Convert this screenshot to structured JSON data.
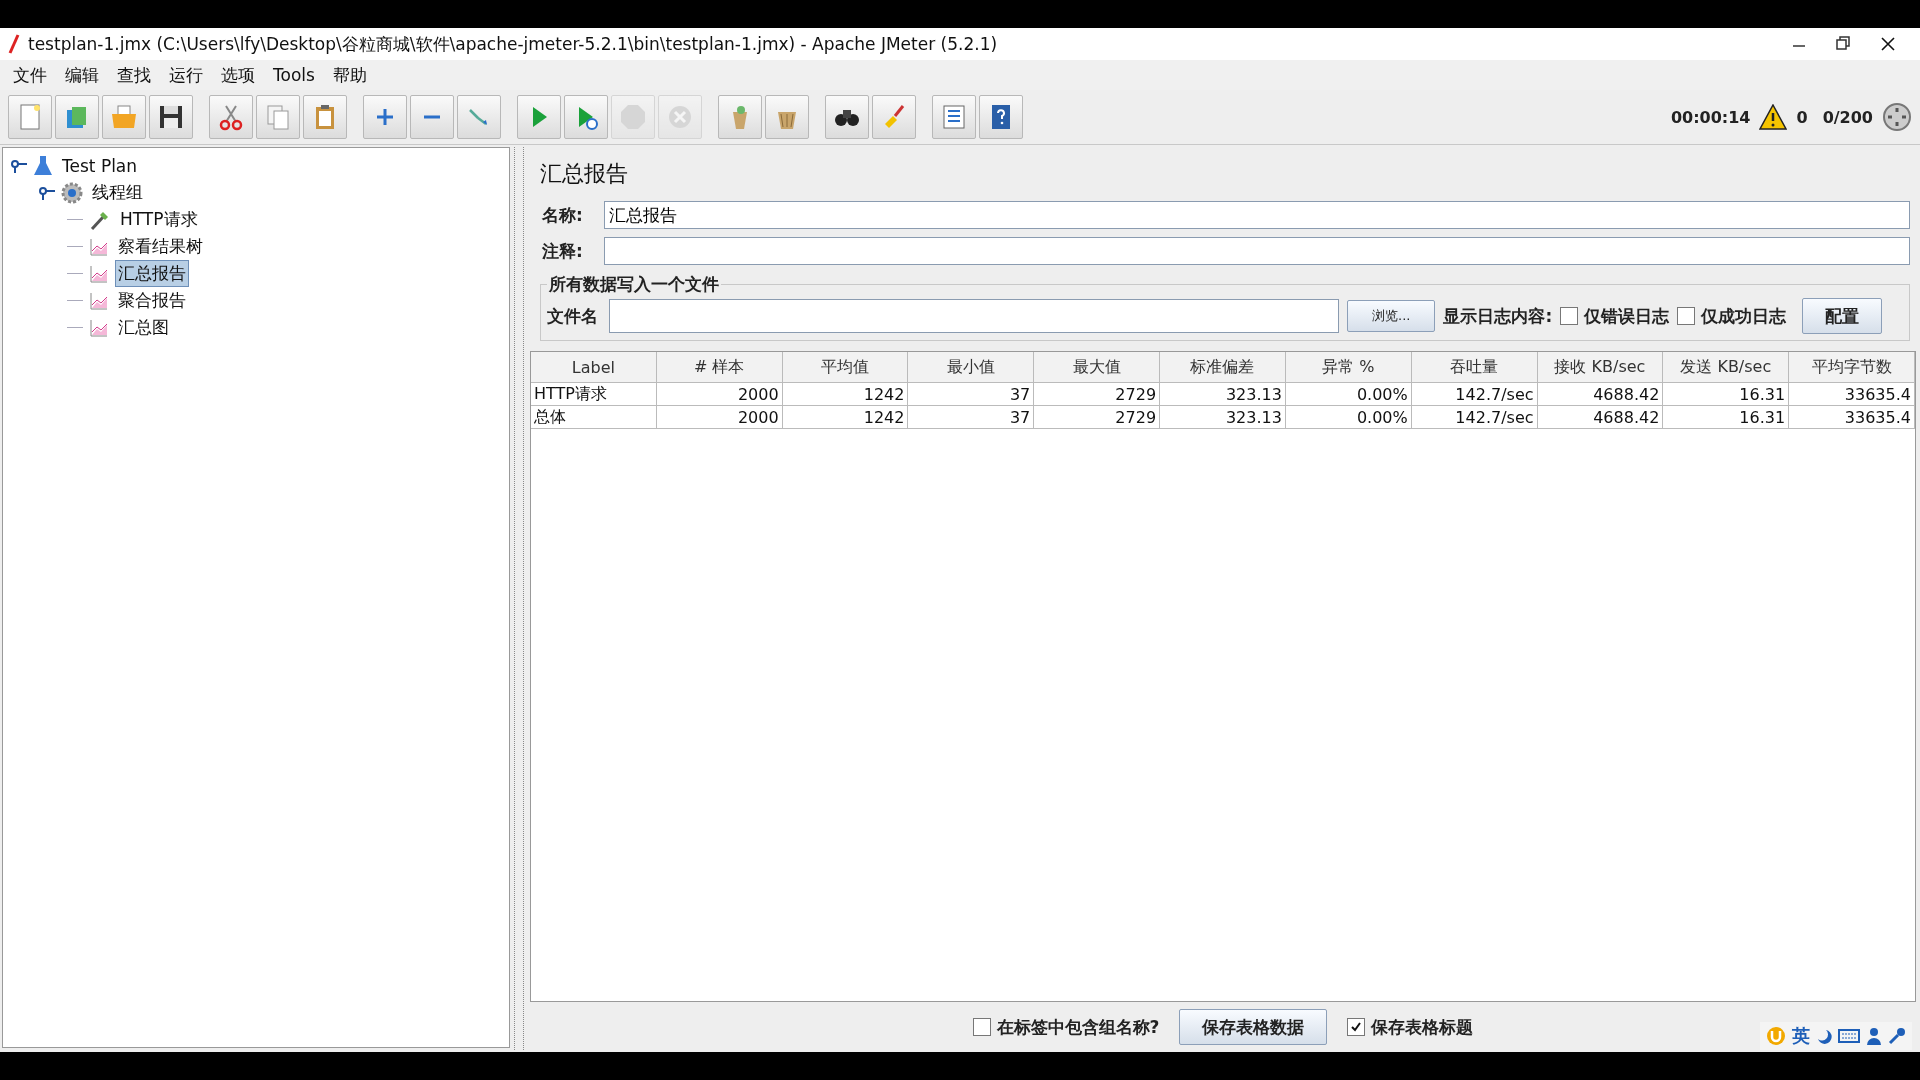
{
  "window": {
    "title": "testplan-1.jmx (C:\\Users\\lfy\\Desktop\\谷粒商城\\软件\\apache-jmeter-5.2.1\\bin\\testplan-1.jmx) - Apache JMeter (5.2.1)"
  },
  "menu": [
    {
      "label": "文件"
    },
    {
      "label": "编辑"
    },
    {
      "label": "查找"
    },
    {
      "label": "运行"
    },
    {
      "label": "选项"
    },
    {
      "label": "Tools"
    },
    {
      "label": "帮助"
    }
  ],
  "toolbar": [
    {
      "kind": "new",
      "disabled": false
    },
    {
      "kind": "templates",
      "disabled": false
    },
    {
      "kind": "open",
      "disabled": false
    },
    {
      "kind": "save",
      "disabled": false
    },
    {
      "kind": "sep"
    },
    {
      "kind": "cut",
      "disabled": false
    },
    {
      "kind": "copy",
      "disabled": false
    },
    {
      "kind": "paste",
      "disabled": false
    },
    {
      "kind": "sep"
    },
    {
      "kind": "expand",
      "disabled": false
    },
    {
      "kind": "collapse",
      "disabled": false
    },
    {
      "kind": "toggle",
      "disabled": false
    },
    {
      "kind": "sep"
    },
    {
      "kind": "start",
      "disabled": false
    },
    {
      "kind": "start_no_pause",
      "disabled": false
    },
    {
      "kind": "stop",
      "disabled": true
    },
    {
      "kind": "shutdown",
      "disabled": true
    },
    {
      "kind": "sep"
    },
    {
      "kind": "clear",
      "disabled": false
    },
    {
      "kind": "clear_all",
      "disabled": false
    },
    {
      "kind": "sep"
    },
    {
      "kind": "search",
      "disabled": false
    },
    {
      "kind": "reset_search",
      "disabled": false
    },
    {
      "kind": "sep"
    },
    {
      "kind": "function_helper",
      "disabled": false
    },
    {
      "kind": "help",
      "disabled": false
    }
  ],
  "status": {
    "elapsed": "00:00:14",
    "warnings": "0",
    "threads": "0/200"
  },
  "tree": [
    {
      "label": "Test Plan",
      "kind": "plan",
      "selected": false,
      "expanded": true,
      "children": [
        {
          "label": "线程组",
          "kind": "thread_group",
          "selected": false,
          "expanded": true,
          "children": [
            {
              "label": "HTTP请求",
              "kind": "sampler",
              "selected": false
            },
            {
              "label": "察看结果树",
              "kind": "listener",
              "selected": false
            },
            {
              "label": "汇总报告",
              "kind": "listener",
              "selected": true
            },
            {
              "label": "聚合报告",
              "kind": "listener",
              "selected": false
            },
            {
              "label": "汇总图",
              "kind": "listener",
              "selected": false
            }
          ]
        }
      ]
    }
  ],
  "panel": {
    "title": "汇总报告",
    "name_label": "名称:",
    "name_value": "汇总报告",
    "comment_label": "注释:"
  },
  "file_group": {
    "title": "所有数据写入一个文件",
    "filename_label": "文件名",
    "browse_button": "浏览...",
    "log_label": "显示日志内容:",
    "checkboxes": [
      {
        "label": "仅错误日志",
        "checked": false
      },
      {
        "label": "仅成功日志",
        "checked": false
      }
    ],
    "configure_button": "配置"
  },
  "table": {
    "columns": [
      "Label",
      "# 样本",
      "平均值",
      "最小值",
      "最大值",
      "标准偏差",
      "异常 %",
      "吞吐量",
      "接收 KB/sec",
      "发送 KB/sec",
      "平均字节数"
    ],
    "rows": [
      [
        "HTTP请求",
        "2000",
        "1242",
        "37",
        "2729",
        "323.13",
        "0.00%",
        "142.7/sec",
        "4688.42",
        "16.31",
        "33635.4"
      ],
      [
        "总体",
        "2000",
        "1242",
        "37",
        "2729",
        "323.13",
        "0.00%",
        "142.7/sec",
        "4688.42",
        "16.31",
        "33635.4"
      ]
    ]
  },
  "footer": [
    {
      "kind": "checkbox",
      "label": "在标签中包含组名称?",
      "checked": false
    },
    {
      "kind": "button",
      "label": "保存表格数据"
    },
    {
      "kind": "checkbox",
      "label": "保存表格标题",
      "checked": true
    }
  ],
  "ime_bar": {
    "label": "英"
  }
}
